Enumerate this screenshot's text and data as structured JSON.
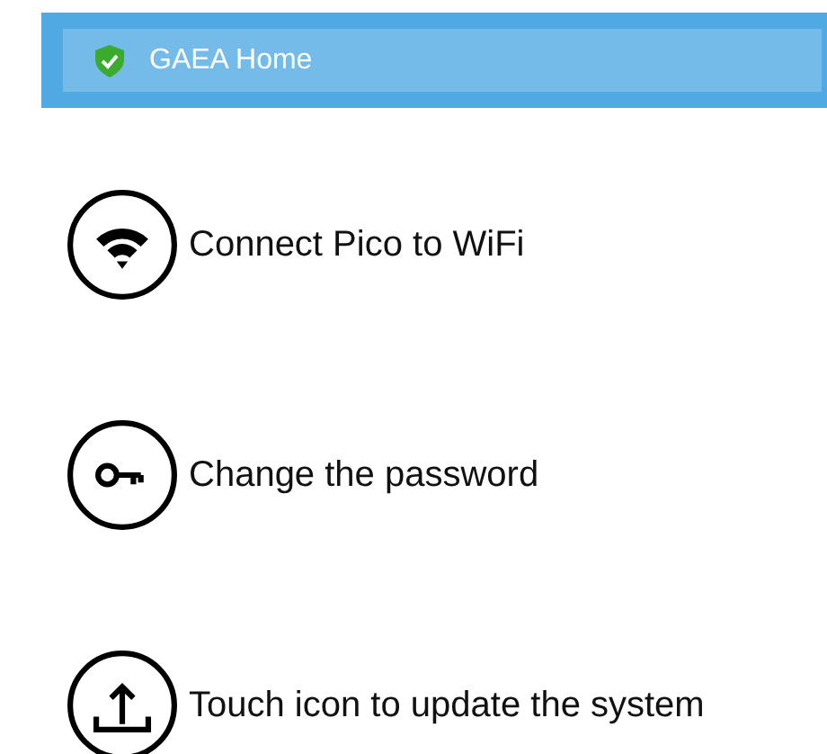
{
  "header": {
    "title": "GAEA Home"
  },
  "actions": [
    {
      "kind": "wifi",
      "label": "Connect Pico to WiFi"
    },
    {
      "kind": "key",
      "label": "Change the password"
    },
    {
      "kind": "upload",
      "label": "Touch icon to update the system"
    }
  ]
}
